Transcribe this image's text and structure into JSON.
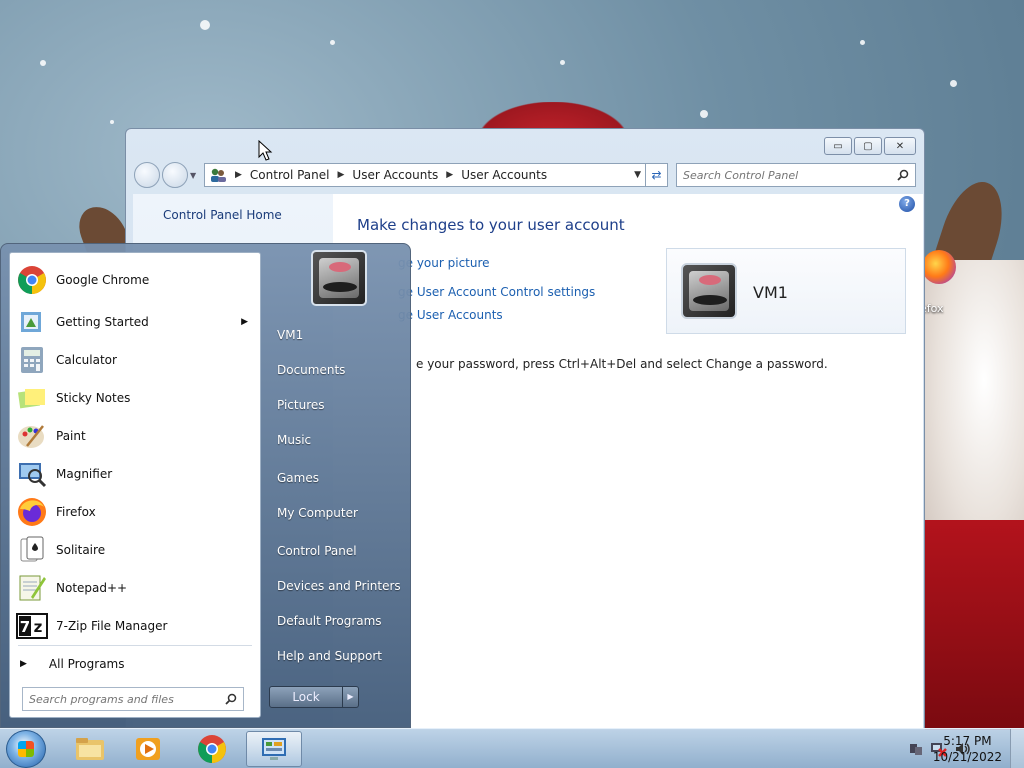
{
  "desktop": {
    "icon_label": "efox"
  },
  "window": {
    "caption_buttons": {
      "minimize": "▭",
      "maximize": "▢",
      "close": "✕"
    },
    "breadcrumb": [
      "Control Panel",
      "User Accounts",
      "User Accounts"
    ],
    "search_placeholder": "Search Control Panel",
    "left_pane": {
      "home_link": "Control Panel Home"
    },
    "main": {
      "title": "Make changes to your user account",
      "links": [
        "ge your picture",
        "ge User Account Control settings",
        "ge User Accounts"
      ],
      "password_note": "e your password, press Ctrl+Alt+Del and select Change a password."
    },
    "user_card": {
      "name": "VM1"
    }
  },
  "start_menu": {
    "programs": [
      {
        "label": "Google Chrome",
        "icon": "chrome-icon"
      },
      {
        "label": "Getting Started",
        "icon": "getting-started-icon",
        "has_submenu": true
      },
      {
        "label": "Calculator",
        "icon": "calculator-icon"
      },
      {
        "label": "Sticky Notes",
        "icon": "sticky-notes-icon"
      },
      {
        "label": "Paint",
        "icon": "paint-icon"
      },
      {
        "label": "Magnifier",
        "icon": "magnifier-icon"
      },
      {
        "label": "Firefox",
        "icon": "firefox-icon"
      },
      {
        "label": "Solitaire",
        "icon": "solitaire-icon"
      },
      {
        "label": "Notepad++",
        "icon": "notepadpp-icon"
      },
      {
        "label": "7-Zip File Manager",
        "icon": "7zip-icon"
      }
    ],
    "all_programs": "All Programs",
    "search_placeholder": "Search programs and files",
    "right_links": [
      "VM1",
      "Documents",
      "Pictures",
      "Music",
      "Games",
      "My Computer",
      "Control Panel",
      "Devices and Printers",
      "Default Programs",
      "Help and Support"
    ],
    "lock_label": "Lock"
  },
  "taskbar": {
    "clock_time": "5:17 PM",
    "clock_date": "10/21/2022"
  }
}
